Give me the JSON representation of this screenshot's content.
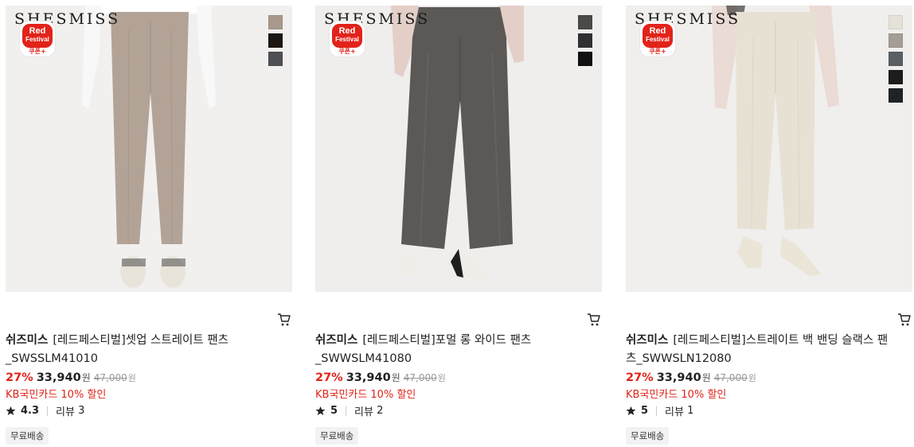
{
  "products": [
    {
      "brand_mark": "SHESMISS",
      "badge": {
        "line1": "Red",
        "line2": "Festival",
        "line3": "쿠폰+"
      },
      "swatches": [
        "#a8998c",
        "#1c1712",
        "#4e5054"
      ],
      "pants_color": "#b3a397",
      "shoe_color": "#e9e4da",
      "brand": "쉬즈미스",
      "name": "[레드페스티벌]셋업 스트레이트 팬츠_SWSSLM41010",
      "discount": "27%",
      "price": "33,940",
      "currency": "원",
      "original_price": "47,000",
      "original_currency": "원",
      "card_promo": "KB국민카드 10% 할인",
      "rating": "4.3",
      "review_label": "리뷰",
      "review_count": "3",
      "tag": "무료배송"
    },
    {
      "brand_mark": "SHESMISS",
      "badge": {
        "line1": "Red",
        "line2": "Festival",
        "line3": "쿠폰+"
      },
      "swatches": [
        "#4a4a48",
        "#2f3033",
        "#111111"
      ],
      "pants_color": "#5b5856",
      "shoe_color": "#f0ede8",
      "brand": "쉬즈미스",
      "name": "[레드페스티벌]포멀 롱 와이드 팬츠_SWWSLM41080",
      "discount": "27%",
      "price": "33,940",
      "currency": "원",
      "original_price": "47,000",
      "original_currency": "원",
      "card_promo": "KB국민카드 10% 할인",
      "rating": "5",
      "review_label": "리뷰",
      "review_count": "2",
      "tag": "무료배송"
    },
    {
      "brand_mark": "SHESMISS",
      "badge": {
        "line1": "Red",
        "line2": "Festival",
        "line3": "쿠폰+"
      },
      "swatches": [
        "#e6e1d7",
        "#a39d94",
        "#5a5f63",
        "#1c1c1c",
        "#202326"
      ],
      "pants_color": "#e7e1d4",
      "shoe_color": "#ebe5d8",
      "brand": "쉬즈미스",
      "name": "[레드페스티벌]스트레이트 백 밴딩 슬랙스 팬츠_SWWSLN12080",
      "discount": "27%",
      "price": "33,940",
      "currency": "원",
      "original_price": "47,000",
      "original_currency": "원",
      "card_promo": "KB국민카드 10% 할인",
      "rating": "5",
      "review_label": "리뷰",
      "review_count": "1",
      "tag": "무료배송"
    }
  ]
}
